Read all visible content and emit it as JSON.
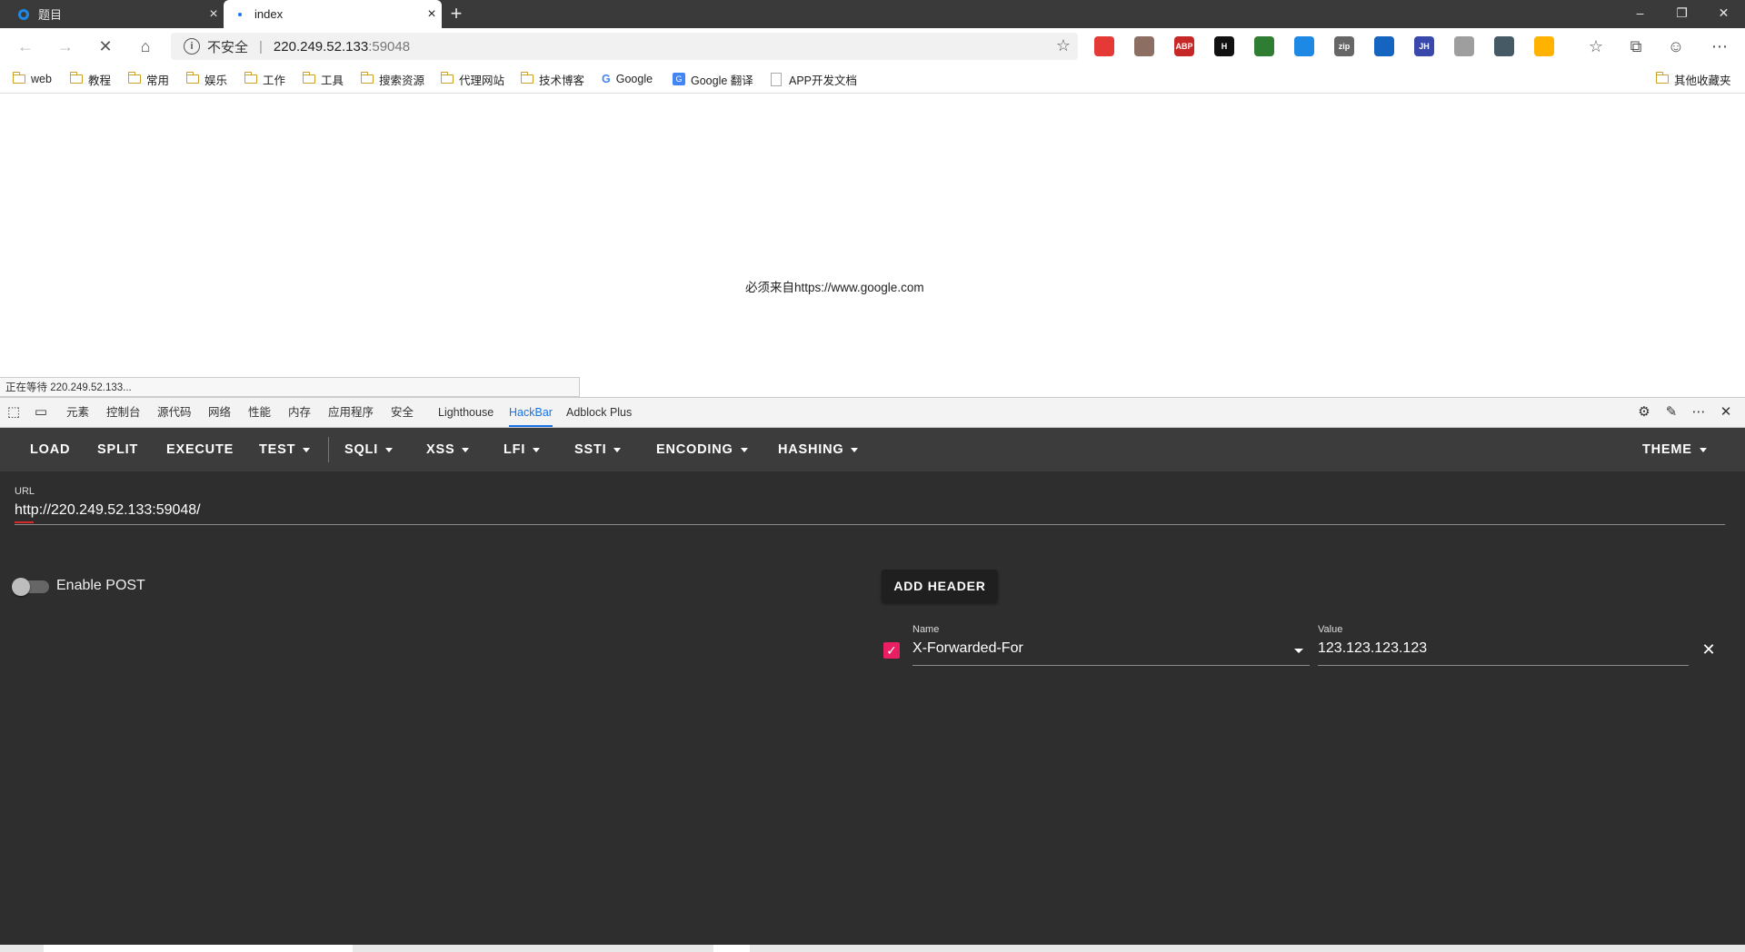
{
  "browser": {
    "tabs": [
      {
        "title": "题目",
        "active": false
      },
      {
        "title": "index",
        "active": true
      }
    ],
    "address": {
      "security_label": "不安全",
      "host": "220.249.52.133",
      "port": ":59048"
    },
    "extensions": [
      {
        "icon": "infinity-extension-icon",
        "label": "",
        "color": "#e53935"
      },
      {
        "icon": "owl-extension-icon",
        "label": "",
        "color": "#8d6e63"
      },
      {
        "icon": "adblock-plus-icon",
        "label": "ABP",
        "color": "#c62828"
      },
      {
        "icon": "h-extension-icon",
        "label": "H",
        "color": "#111111"
      },
      {
        "icon": "paw-extension-icon",
        "label": "",
        "color": "#2e7d32"
      },
      {
        "icon": "globe-extension-icon",
        "label": "",
        "color": "#1e88e5"
      },
      {
        "icon": "zip-extension-icon",
        "label": "zip",
        "color": "#666666"
      },
      {
        "icon": "image-extension-icon",
        "label": "",
        "color": "#1565c0"
      },
      {
        "icon": "jh-extension-icon",
        "label": "JH",
        "color": "#3949ab"
      },
      {
        "icon": "cursor-extension-icon",
        "label": "",
        "color": "#9e9e9e"
      },
      {
        "icon": "chat-extension-icon",
        "label": "",
        "color": "#455a64"
      },
      {
        "icon": "color-extension-icon",
        "label": "",
        "color": "#ffb300"
      }
    ],
    "bookmarks": [
      {
        "label": "web",
        "type": "folder"
      },
      {
        "label": "教程",
        "type": "folder"
      },
      {
        "label": "常用",
        "type": "folder"
      },
      {
        "label": "娱乐",
        "type": "folder"
      },
      {
        "label": "工作",
        "type": "folder"
      },
      {
        "label": "工具",
        "type": "folder"
      },
      {
        "label": "搜索资源",
        "type": "folder"
      },
      {
        "label": "代理网站",
        "type": "folder"
      },
      {
        "label": "技术博客",
        "type": "folder"
      },
      {
        "label": "Google",
        "type": "link"
      },
      {
        "label": "Google 翻译",
        "type": "link"
      },
      {
        "label": "APP开发文档",
        "type": "link"
      }
    ],
    "other_bookmarks": "其他收藏夹",
    "status_text": "正在等待 220.249.52.133..."
  },
  "page": {
    "message": "必须来自https://www.google.com"
  },
  "devtools": {
    "tabs": [
      "元素",
      "控制台",
      "源代码",
      "网络",
      "性能",
      "内存",
      "应用程序",
      "安全",
      "Lighthouse",
      "HackBar",
      "Adblock Plus"
    ],
    "active_tab": "HackBar"
  },
  "hackbar": {
    "menu": [
      {
        "label": "LOAD",
        "dropdown": false
      },
      {
        "label": "SPLIT",
        "dropdown": false
      },
      {
        "label": "EXECUTE",
        "dropdown": false
      },
      {
        "label": "TEST",
        "dropdown": true
      },
      {
        "label": "SQLI",
        "dropdown": true
      },
      {
        "label": "XSS",
        "dropdown": true
      },
      {
        "label": "LFI",
        "dropdown": true
      },
      {
        "label": "SSTI",
        "dropdown": true
      },
      {
        "label": "ENCODING",
        "dropdown": true
      },
      {
        "label": "HASHING",
        "dropdown": true
      }
    ],
    "theme_label": "THEME",
    "url_label": "URL",
    "url_value": "http://220.249.52.133:59048/",
    "enable_post_label": "Enable POST",
    "enable_post": false,
    "add_header_label": "ADD HEADER",
    "header": {
      "enabled": true,
      "name_label": "Name",
      "name_value": "X-Forwarded-For",
      "value_label": "Value",
      "value_value": "123.123.123.123"
    },
    "accent_color": "#e91e63"
  }
}
